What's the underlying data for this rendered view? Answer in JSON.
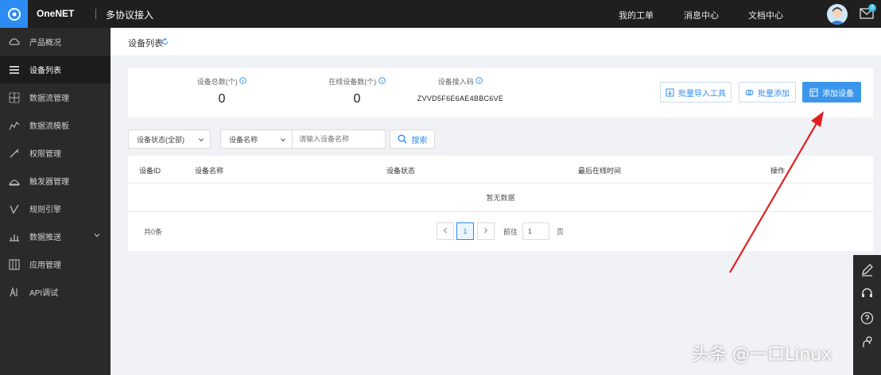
{
  "topbar": {
    "brand": "OneNET",
    "product": "多协议接入",
    "nav": [
      "我的工单",
      "消息中心",
      "文档中心"
    ],
    "mail_badge": "3"
  },
  "sidebar": {
    "items": [
      {
        "label": "产品概况",
        "icon": "cloud-icon"
      },
      {
        "label": "设备列表",
        "icon": "list-icon"
      },
      {
        "label": "数据流管理",
        "icon": "grid-icon"
      },
      {
        "label": "数据流模板",
        "icon": "chart-line-icon"
      },
      {
        "label": "权限管理",
        "icon": "key-icon"
      },
      {
        "label": "触发器管理",
        "icon": "trigger-icon"
      },
      {
        "label": "规则引擎",
        "icon": "rule-icon"
      },
      {
        "label": "数据推送",
        "icon": "push-icon"
      },
      {
        "label": "应用管理",
        "icon": "app-icon"
      },
      {
        "label": "API调试",
        "icon": "api-icon"
      }
    ]
  },
  "breadcrumb": "设备列表",
  "stats": [
    {
      "label": "设备总数(个)",
      "value": "0"
    },
    {
      "label": "在线设备数(个)",
      "value": "0"
    },
    {
      "label": "设备接入码",
      "value": "ZVVD5F6E6AE4BBC6VE"
    }
  ],
  "buttons": {
    "batch_import": "批量导入工具",
    "batch_add": "批量添加",
    "add_device": "添加设备"
  },
  "filters": {
    "status": "设备状态(全部)",
    "field": "设备名称",
    "placeholder": "请输入设备名称",
    "search": "搜索"
  },
  "table": {
    "columns": [
      "设备ID",
      "设备名称",
      "设备状态",
      "最后在线时间",
      "操作"
    ],
    "empty": "暂无数据"
  },
  "pagination": {
    "total": "共0条",
    "current": "1",
    "goto_label": "前往",
    "goto_value": "1",
    "goto_suffix": "页"
  },
  "watermark": "头条 @一口Linux",
  "colors": {
    "accent": "#2c8cf4",
    "sidebar": "#2a2a2a",
    "topbar": "#1f1f1f",
    "arrow": "#e02020"
  }
}
